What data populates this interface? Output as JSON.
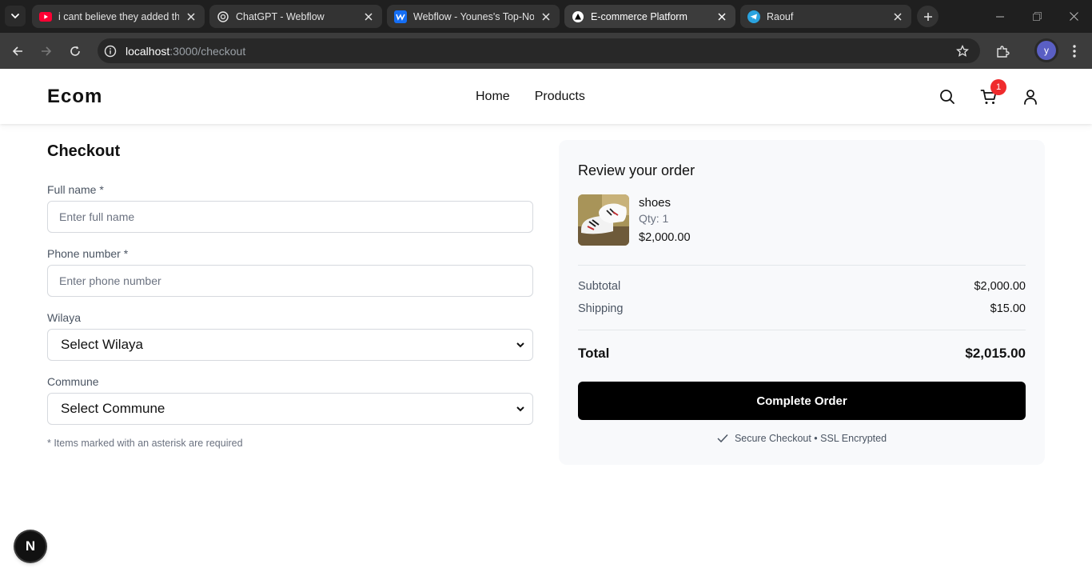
{
  "browser": {
    "tabs": [
      {
        "title": "i cant believe they added thi",
        "favicon": "youtube-icon"
      },
      {
        "title": "ChatGPT - Webflow",
        "favicon": "chatgpt-icon"
      },
      {
        "title": "Webflow - Younes's Top-Not",
        "favicon": "webflow-icon"
      },
      {
        "title": "E-commerce Platform",
        "favicon": "nextjs-icon",
        "active": true
      },
      {
        "title": "Raouf",
        "favicon": "telegram-icon"
      }
    ],
    "url_host": "localhost",
    "url_path": ":3000/checkout",
    "profile_initial": "y"
  },
  "header": {
    "logo": "Ecom",
    "nav": [
      "Home",
      "Products"
    ],
    "cart_count": "1"
  },
  "checkout": {
    "title": "Checkout",
    "full_name_label": "Full name *",
    "full_name_placeholder": "Enter full name",
    "phone_label": "Phone number *",
    "phone_placeholder": "Enter phone number",
    "wilaya_label": "Wilaya",
    "wilaya_value": "Select Wilaya",
    "commune_label": "Commune",
    "commune_value": "Select Commune",
    "required_note": "* Items marked with an asterisk are required"
  },
  "summary": {
    "title": "Review your order",
    "item": {
      "name": "shoes",
      "qty": "Qty: 1",
      "price": "$2,000.00"
    },
    "subtotal_label": "Subtotal",
    "subtotal_value": "$2,000.00",
    "shipping_label": "Shipping",
    "shipping_value": "$15.00",
    "total_label": "Total",
    "total_value": "$2,015.00",
    "cta_label": "Complete Order",
    "secure_text": "Secure Checkout • SSL Encrypted"
  },
  "dev_badge": "N",
  "colors": {
    "cart_badge": "#ef2b2d",
    "cta_background": "#000000",
    "summary_background": "#f8f9fb"
  }
}
